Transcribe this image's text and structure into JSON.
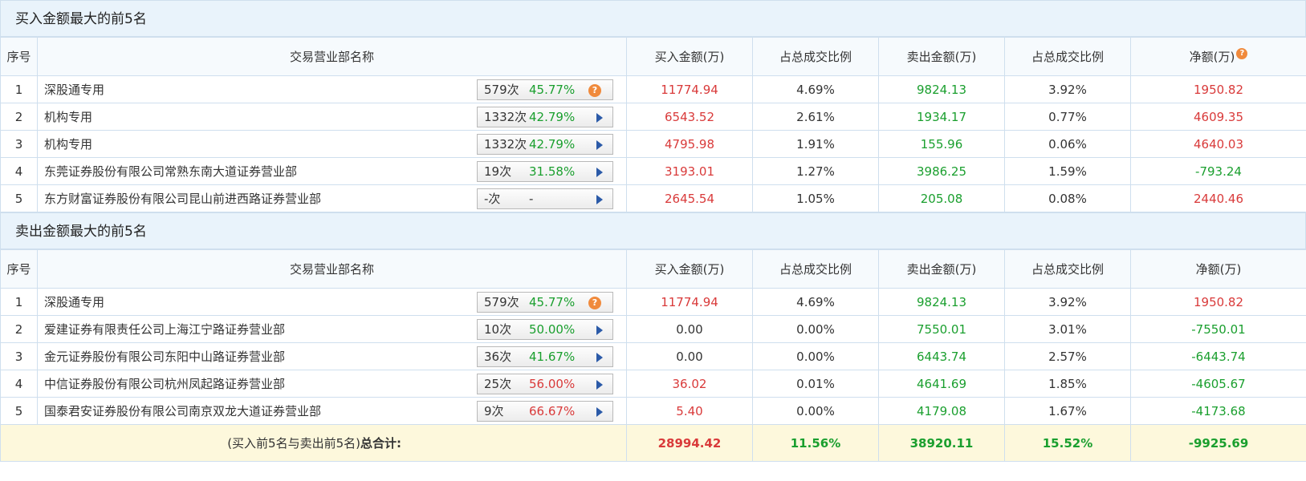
{
  "colors": {
    "positive": "#d93a3a",
    "negative": "#1a9f2e",
    "header_bg": "#e9f3fb",
    "total_bg": "#fdf8dc"
  },
  "columns": [
    "序号",
    "交易营业部名称",
    "买入金额(万)",
    "占总成交比例",
    "卖出金额(万)",
    "占总成交比例",
    "净额(万)"
  ],
  "buy_section": {
    "title": "买入金额最大的前5名",
    "rows": [
      {
        "idx": "1",
        "name": "深股通专用",
        "count": "579次",
        "pct": "45.77%",
        "pct_color": "green",
        "icon": "question-icon",
        "buy": "11774.94",
        "buy_ratio": "4.69%",
        "sell": "9824.13",
        "sell_ratio": "3.92%",
        "net": "1950.82",
        "net_color": "red"
      },
      {
        "idx": "2",
        "name": "机构专用",
        "count": "1332次",
        "pct": "42.79%",
        "pct_color": "green",
        "icon": "arrow-right-icon",
        "buy": "6543.52",
        "buy_ratio": "2.61%",
        "sell": "1934.17",
        "sell_ratio": "0.77%",
        "net": "4609.35",
        "net_color": "red"
      },
      {
        "idx": "3",
        "name": "机构专用",
        "count": "1332次",
        "pct": "42.79%",
        "pct_color": "green",
        "icon": "arrow-right-icon",
        "buy": "4795.98",
        "buy_ratio": "1.91%",
        "sell": "155.96",
        "sell_ratio": "0.06%",
        "net": "4640.03",
        "net_color": "red"
      },
      {
        "idx": "4",
        "name": "东莞证券股份有限公司常熟东南大道证券营业部",
        "count": "19次",
        "pct": "31.58%",
        "pct_color": "green",
        "icon": "arrow-right-icon",
        "buy": "3193.01",
        "buy_ratio": "1.27%",
        "sell": "3986.25",
        "sell_ratio": "1.59%",
        "net": "-793.24",
        "net_color": "green"
      },
      {
        "idx": "5",
        "name": "东方财富证券股份有限公司昆山前进西路证券营业部",
        "count": "-次",
        "pct": "-",
        "pct_color": "grey",
        "icon": "arrow-right-icon",
        "buy": "2645.54",
        "buy_ratio": "1.05%",
        "sell": "205.08",
        "sell_ratio": "0.08%",
        "net": "2440.46",
        "net_color": "red"
      }
    ]
  },
  "sell_section": {
    "title": "卖出金额最大的前5名",
    "rows": [
      {
        "idx": "1",
        "name": "深股通专用",
        "count": "579次",
        "pct": "45.77%",
        "pct_color": "green",
        "icon": "question-icon",
        "buy": "11774.94",
        "buy_ratio": "4.69%",
        "sell": "9824.13",
        "sell_ratio": "3.92%",
        "net": "1950.82",
        "net_color": "red",
        "buy_color": "red"
      },
      {
        "idx": "2",
        "name": "爱建证券有限责任公司上海江宁路证券营业部",
        "count": "10次",
        "pct": "50.00%",
        "pct_color": "green",
        "icon": "arrow-right-icon",
        "buy": "0.00",
        "buy_ratio": "0.00%",
        "sell": "7550.01",
        "sell_ratio": "3.01%",
        "net": "-7550.01",
        "net_color": "green",
        "buy_color": "dark"
      },
      {
        "idx": "3",
        "name": "金元证券股份有限公司东阳中山路证券营业部",
        "count": "36次",
        "pct": "41.67%",
        "pct_color": "green",
        "icon": "arrow-right-icon",
        "buy": "0.00",
        "buy_ratio": "0.00%",
        "sell": "6443.74",
        "sell_ratio": "2.57%",
        "net": "-6443.74",
        "net_color": "green",
        "buy_color": "dark"
      },
      {
        "idx": "4",
        "name": "中信证券股份有限公司杭州凤起路证券营业部",
        "count": "25次",
        "pct": "56.00%",
        "pct_color": "red",
        "icon": "arrow-right-icon",
        "buy": "36.02",
        "buy_ratio": "0.01%",
        "sell": "4641.69",
        "sell_ratio": "1.85%",
        "net": "-4605.67",
        "net_color": "green",
        "buy_color": "red"
      },
      {
        "idx": "5",
        "name": "国泰君安证券股份有限公司南京双龙大道证券营业部",
        "count": "9次",
        "pct": "66.67%",
        "pct_color": "red",
        "icon": "arrow-right-icon",
        "buy": "5.40",
        "buy_ratio": "0.00%",
        "sell": "4179.08",
        "sell_ratio": "1.67%",
        "net": "-4173.68",
        "net_color": "green",
        "buy_color": "red"
      }
    ]
  },
  "total": {
    "label_prefix": "(买入前5名与卖出前5名)",
    "label_bold": "总合计:",
    "buy": "28994.42",
    "buy_ratio": "11.56%",
    "sell": "38920.11",
    "sell_ratio": "15.52%",
    "net": "-9925.69"
  }
}
